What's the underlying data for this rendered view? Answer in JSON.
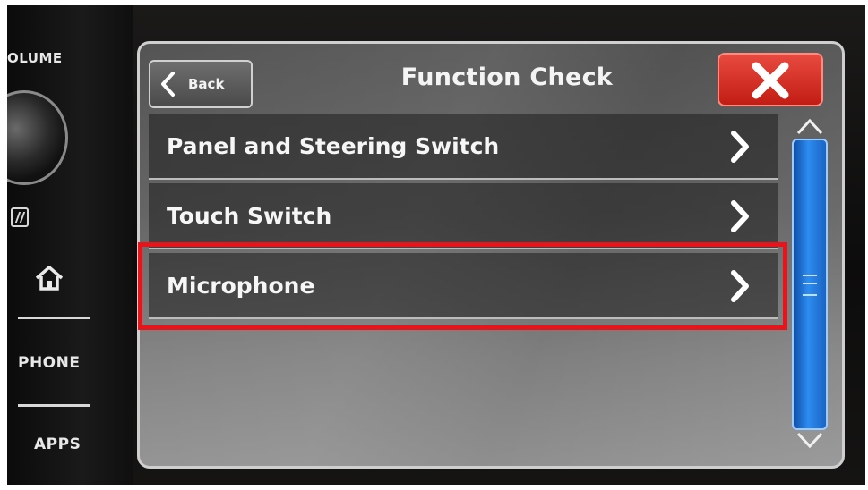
{
  "bezel": {
    "volume_label": "OLUME",
    "phone_label": "PHONE",
    "apps_label": "APPS"
  },
  "header": {
    "back_label": "Back",
    "title": "Function Check"
  },
  "menu": {
    "items": [
      {
        "label": "Panel and Steering Switch"
      },
      {
        "label": "Touch Switch"
      },
      {
        "label": "Microphone"
      }
    ]
  },
  "colors": {
    "highlight": "#e8141c",
    "close_button": "#c21d14",
    "scrollbar": "#2d8cf0"
  },
  "icons": {
    "back": "chevron-left-icon",
    "close": "close-icon",
    "row": "chevron-right-icon",
    "scroll_up": "chevron-up-icon",
    "scroll_down": "chevron-down-icon",
    "home": "home-icon",
    "nfc": "nfc-icon"
  }
}
